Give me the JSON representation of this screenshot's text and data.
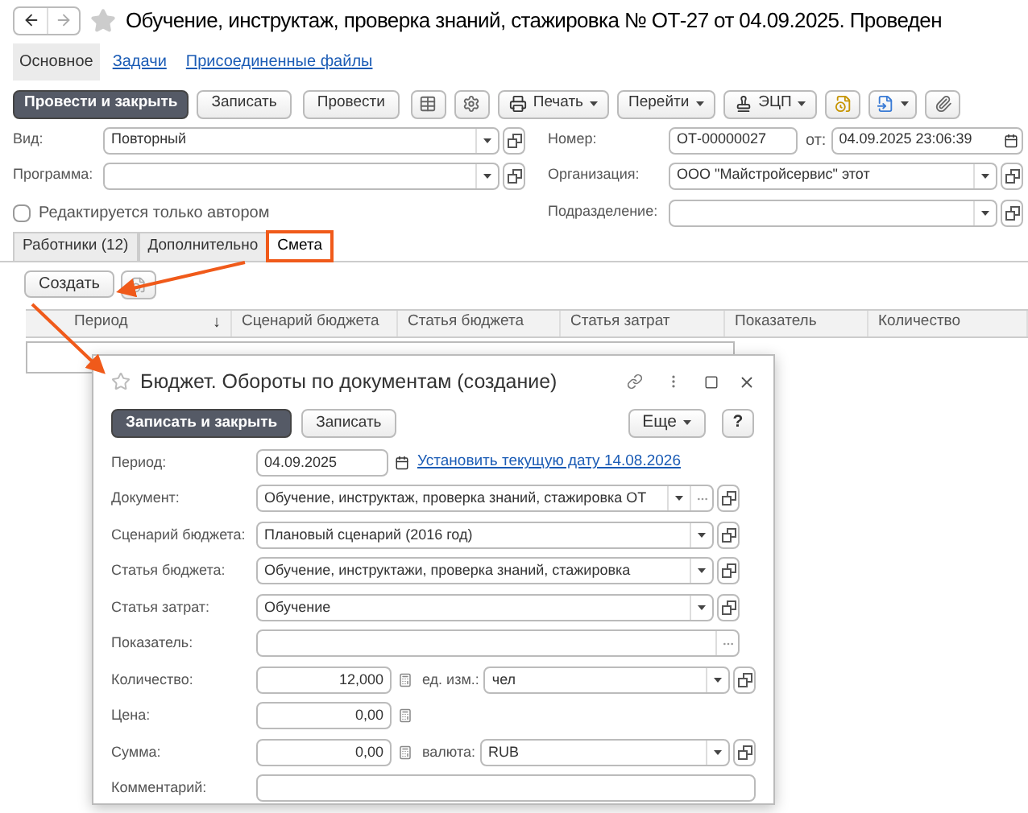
{
  "window": {
    "title": "Обучение, инструктаж, проверка знаний, стажировка № ОТ-27 от 04.09.2025. Проведен"
  },
  "sections": [
    {
      "label": "Основное",
      "selected": true
    },
    {
      "label": "Задачи",
      "selected": false
    },
    {
      "label": "Присоединенные файлы",
      "selected": false
    }
  ],
  "toolbar": {
    "buttons": [
      {
        "label": "Провести и закрыть",
        "kind": "primary"
      },
      {
        "label": "Записать",
        "kind": "plain"
      },
      {
        "label": "Провести",
        "kind": "plain"
      }
    ],
    "menus": [
      {
        "label": "Печать"
      },
      {
        "label": "Перейти"
      },
      {
        "label": "ЭЦП"
      }
    ]
  },
  "fields_left": [
    {
      "label": "Вид:",
      "value": "Повторный"
    },
    {
      "label": "Программа:"
    }
  ],
  "number": {
    "label": "Номер:",
    "value": "ОТ-00000027"
  },
  "date": {
    "label": "от:",
    "value": "04.09.2025 23:06:39"
  },
  "organization": {
    "label": "Организация:",
    "value": "ООО \"Майстройсервис\" этот"
  },
  "subdivision": {
    "label": "Подразделение:"
  },
  "author_only": {
    "label": "Редактируется только автором",
    "checked": false
  },
  "tabs": [
    {
      "label": "Работники (12)",
      "selected": false,
      "highlighted": false
    },
    {
      "label": "Дополнительно",
      "selected": false,
      "highlighted": false
    },
    {
      "label": "Смета",
      "selected": true,
      "highlighted": true
    }
  ],
  "create_button": "Создать",
  "table": {
    "columns": [
      {
        "label": "Период",
        "sort_mark": "↓"
      },
      {
        "label": "Сценарий бюджета"
      },
      {
        "label": "Статья бюджета"
      },
      {
        "label": "Статья затрат"
      },
      {
        "label": "Показатель"
      },
      {
        "label": "Количество"
      }
    ]
  },
  "dialog": {
    "title": "Бюджет. Обороты по документам (создание)",
    "buttons": [
      {
        "label": "Записать и закрыть",
        "kind": "primary"
      },
      {
        "label": "Записать",
        "kind": "plain"
      }
    ],
    "more": "Еще",
    "help": "?",
    "fields": [
      {
        "kind": "date",
        "label": "Период:",
        "value": "04.09.2025",
        "link": "Установить текущую дату 14.08.2026"
      },
      {
        "kind": "choice",
        "label": "Документ:",
        "value": "Обучение, инструктаж, проверка знаний, стажировка ОТ"
      },
      {
        "kind": "select",
        "label": "Сценарий бюджета:",
        "value": "Плановый сценарий (2016 год)"
      },
      {
        "kind": "select",
        "label": "Статья бюджета:",
        "value": "Обучение, инструктажи, проверка знаний, стажировка"
      },
      {
        "kind": "select",
        "label": "Статья затрат:",
        "value": "Обучение"
      },
      {
        "kind": "pick",
        "label": "Показатель:"
      },
      {
        "kind": "number",
        "label": "Количество:",
        "value": "12,000",
        "extra": {
          "label": "ед. изм.:",
          "value": "чел"
        }
      },
      {
        "kind": "number",
        "label": "Цена:",
        "value": "0,00"
      },
      {
        "kind": "number",
        "label": "Сумма:",
        "value": "0,00",
        "extra": {
          "label": "валюта:",
          "value": "RUB"
        }
      },
      {
        "kind": "text",
        "label": "Комментарий:"
      }
    ]
  }
}
